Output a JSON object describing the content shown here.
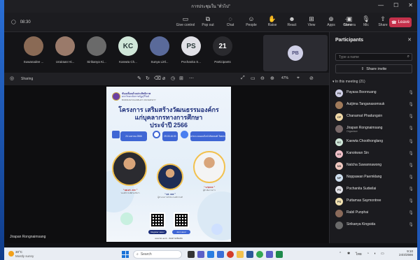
{
  "window": {
    "title": "การประชุมใน \"ทั่วไป\"",
    "controls": [
      "—",
      "☐",
      "✕"
    ]
  },
  "toolbar": {
    "timer": "08:30",
    "items": [
      {
        "label": "Give control",
        "icon": "give-control-icon",
        "glyph": "▭"
      },
      {
        "label": "Pop out",
        "icon": "pop-out-icon",
        "glyph": "⧉"
      },
      {
        "label": "Chat",
        "icon": "chat-icon",
        "glyph": "◌"
      },
      {
        "label": "People",
        "icon": "people-icon",
        "glyph": "☺"
      },
      {
        "label": "Raise",
        "icon": "raise-hand-icon",
        "glyph": "✋"
      },
      {
        "label": "React",
        "icon": "react-icon",
        "glyph": "☻"
      },
      {
        "label": "View",
        "icon": "view-icon",
        "glyph": "⊞"
      },
      {
        "label": "Apps",
        "icon": "apps-icon",
        "glyph": "⊕"
      },
      {
        "label": "More",
        "icon": "more-icon",
        "glyph": "⋯"
      },
      {
        "label": "Camera",
        "icon": "camera-icon",
        "glyph": "▣"
      },
      {
        "label": "Mic",
        "icon": "mic-icon",
        "glyph": "🎙"
      },
      {
        "label": "Share",
        "icon": "share-icon",
        "glyph": "⇧"
      }
    ],
    "leave_label": "Leave"
  },
  "strip": {
    "tiles": [
      {
        "name": "Suwanadee ...",
        "initials": "",
        "color": "#8a6a55"
      },
      {
        "name": "Urairaan Hi...",
        "initials": "",
        "color": "#9a7a6a"
      },
      {
        "name": "Sirikanya Ki...",
        "initials": "",
        "color": "#6a6a6a"
      },
      {
        "name": "Kanwta Ch...",
        "initials": "KC",
        "color": "#cfe6d8"
      },
      {
        "name": "Sunya Lirtl...",
        "initials": "",
        "color": "#5a6a9a"
      },
      {
        "name": "Pochanita S...",
        "initials": "PS",
        "color": "#e0e0e6"
      },
      {
        "name": "Participants",
        "initials": "21",
        "color": "#2a2a2e"
      }
    ],
    "self_initials": "PB"
  },
  "share": {
    "presenter_label": "Sharing",
    "zoom": "47%",
    "presenter_name": "Jirapan Rongnaimsang"
  },
  "poster": {
    "header_line1": "ขับเคลื่อนด้วยประสิทธิภาพ",
    "header_line2": "มหาวิทยาลัยราชภัฏบุรีรัมย์",
    "header_line3": "BURIRAM RAJABHAT UNIVERSITY",
    "title1": "โครงการ เสริมสร้างวัฒนธรรมองค์กร",
    "title2": "แก่บุคลากรทางการศึกษา",
    "title3": "ประจำปี 2566",
    "info_date": "24 เมษายน 2566",
    "info_time": "09.00-16.00",
    "info_venue": "ผ่านระบบออนไลน์ Microsoft Teams",
    "speaker1": "“ ผศ.ดร. xxx ”",
    "speaker1_sub": "รองอธิการบดีฝ่ายบริหาร",
    "speaker2": "“ ดร. xxx ”",
    "speaker2_sub": "ผู้อำนวยการสำนักงานอธิการบดี",
    "speaker3": "“ นายxxx ”",
    "speaker3_sub": "ผู้ดำเนินรายการ",
    "register": "Register Here!",
    "join": "Join Here!",
    "footer": "www.bru.ac.th  ·  สอบถามเพิ่มเติม"
  },
  "panel": {
    "title": "Participants",
    "search_placeholder": "Type a name",
    "share_invite": "Share invite",
    "in_meeting": "In this meeting (21)",
    "people": [
      {
        "name": "Payasa Boonruang",
        "initials": "PB",
        "color": "#cfcfe6",
        "role": ""
      },
      {
        "name": "Autjima Tanganasomsuk",
        "initials": "",
        "color": "#a07a5a",
        "role": ""
      },
      {
        "name": "Chanarnat Phadungsin",
        "initials": "CP",
        "color": "#f1d9a8",
        "role": ""
      },
      {
        "name": "Jirapan Rongnaimsang",
        "initials": "",
        "color": "#7a6a6a",
        "role": "Organiser"
      },
      {
        "name": "Kaewta Choothonglang",
        "initials": "KC",
        "color": "#cfe6d8",
        "role": ""
      },
      {
        "name": "Kanokwan Sin",
        "initials": "KS",
        "color": "#f0c0c8",
        "role": ""
      },
      {
        "name": "Natcha Suwannawong",
        "initials": "NS",
        "color": "#f0c8c0",
        "role": ""
      },
      {
        "name": "Noppawan Paemklang",
        "initials": "NP",
        "color": "#d0e0f0",
        "role": ""
      },
      {
        "name": "Pochanita Sudwilai",
        "initials": "PS",
        "color": "#e0e0e6",
        "role": ""
      },
      {
        "name": "Puttamas Saymontree",
        "initials": "PS",
        "color": "#f0e0b0",
        "role": ""
      },
      {
        "name": "Rabil Punphai",
        "initials": "",
        "color": "#8a6a5a",
        "role": ""
      },
      {
        "name": "Sirikanya Kingsida",
        "initials": "",
        "color": "#6a6a6a",
        "role": ""
      }
    ]
  },
  "taskbar": {
    "temp": "30°C",
    "weather": "Mostly sunny",
    "search_label": "Search",
    "lang": "ไทย",
    "time": "9:10",
    "date": "24/4/2566"
  }
}
